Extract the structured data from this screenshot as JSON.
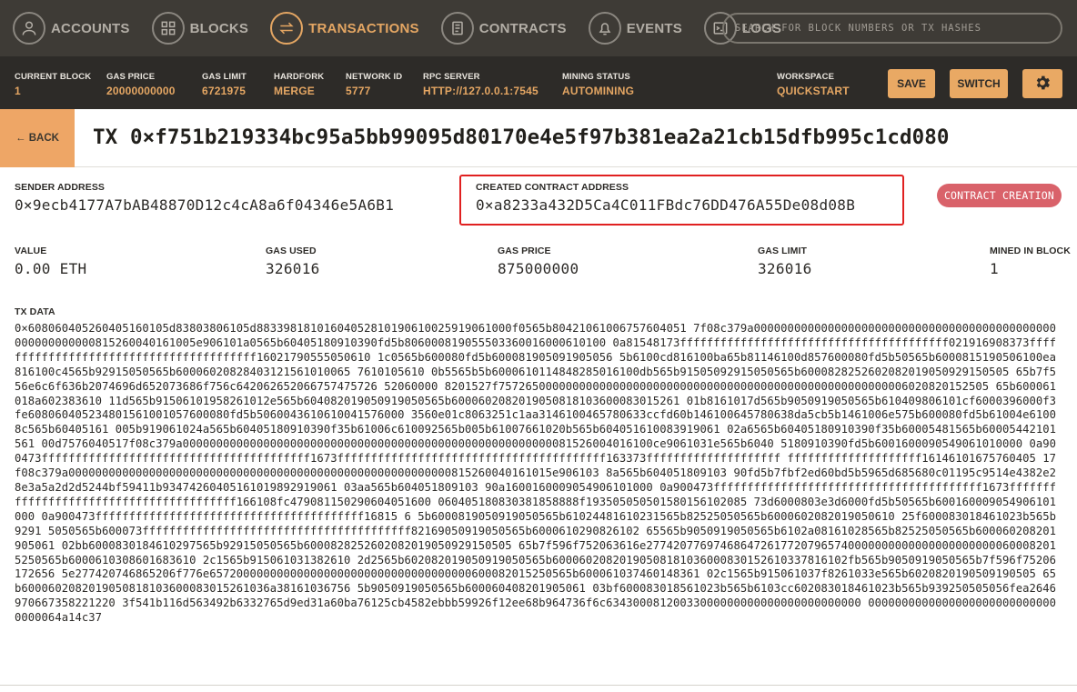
{
  "nav": {
    "items": [
      {
        "label": "ACCOUNTS",
        "icon": "user-icon"
      },
      {
        "label": "BLOCKS",
        "icon": "grid-icon"
      },
      {
        "label": "TRANSACTIONS",
        "icon": "swap-arrows-icon"
      },
      {
        "label": "CONTRACTS",
        "icon": "document-icon"
      },
      {
        "label": "EVENTS",
        "icon": "bell-icon"
      },
      {
        "label": "LOGS",
        "icon": "terminal-icon"
      }
    ],
    "active": "TRANSACTIONS",
    "search_placeholder": "SEARCH FOR BLOCK NUMBERS OR TX HASHES"
  },
  "status": {
    "current_block": {
      "label": "CURRENT BLOCK",
      "value": "1"
    },
    "gas_price": {
      "label": "GAS PRICE",
      "value": "20000000000"
    },
    "gas_limit": {
      "label": "GAS LIMIT",
      "value": "6721975"
    },
    "hardfork": {
      "label": "HARDFORK",
      "value": "MERGE"
    },
    "network_id": {
      "label": "NETWORK ID",
      "value": "5777"
    },
    "rpc_server": {
      "label": "RPC SERVER",
      "value": "HTTP://127.0.0.1:7545"
    },
    "mining_status": {
      "label": "MINING STATUS",
      "value": "AUTOMINING"
    },
    "workspace": {
      "label": "WORKSPACE",
      "value": "QUICKSTART"
    },
    "save_label": "SAVE",
    "switch_label": "SWITCH",
    "settings_icon": "gear-icon"
  },
  "header": {
    "back_label": "← BACK",
    "title": "TX 0×f751b219334bc95a5bb99095d80170e4e5f97b381ea2a21cb15dfb995c1cd080"
  },
  "tx": {
    "sender": {
      "label": "SENDER ADDRESS",
      "value": "0×9ecb4177A7bAB48870D12c4cA8a6f04346e5A6B1"
    },
    "created_contract": {
      "label": "CREATED CONTRACT ADDRESS",
      "value": "0×a8233a432D5Ca4C011FBdc76DD476A55De08d08B"
    },
    "badge": "CONTRACT CREATION",
    "value": {
      "label": "VALUE",
      "value": "0.00 ETH"
    },
    "gas_used": {
      "label": "GAS USED",
      "value": "326016"
    },
    "gas_price": {
      "label": "GAS PRICE",
      "value": "875000000"
    },
    "gas_limit": {
      "label": "GAS LIMIT",
      "value": "326016"
    },
    "mined_in_block": {
      "label": "MINED IN BLOCK",
      "value": "1"
    },
    "data_label": "TX DATA",
    "data": "0×608060405260405160105d83803806105d88339818101604052810190610025919061000f0565b80421061006757604051 7f08c379a000000000000000000000000000000000000000000000000000000000815260040161005e906101a0565b60405180910390fd5b806000819055503360016000610100 0a81548173ffffffffffffffffffffffffffffffffffffffff021916908373ffffffffffffffffffffffffffffffffffffffff16021790555050610 1c0565b600080fd5b600081905091905056 5b6100cd816100ba65b81146100d857600080fd5b50565b6000815190506100ea816100c4565b92915050565b60006020828403121561010065 7610105610 0b5565b5b6000610114848285016100db565b91505092915050565b6000828252602082019050929150505 65b7f556e6c6f636b2074696d652073686f756c642062652066757475726 52060000 8201527f7572650000000000000000000000000000000000000000000000000000006020820152505 65b600061018a602383610 11d565b91506101958261012e565b604082019050919050565b6000602082019050818103600083015261 01b8161017d565b9050919050565b610409806101cf6000396000f3fe608060405234801561001057600080fd5b5060043610610041576000 3560e01c8063251c1aa3146100465780633ccfd60b146100645780638da5cb5b1461006e575b600080fd5b61004e61008c565b60405161 005b919061024a565b60405180910390f35b61006c610092565b005b61007661020b565b604051610083919061 02a6565b60405180910390f35b60005481565b60005442101561 00d7576040517f08c379a0000000000000000000000000000000000000000000000000000000081526004016100ce9061031e565b6040 5180910390fd5b6001600090549061010000 0a900473ffffffffffffffffffffffffffffffffffffffff1673ffffffffffffffffffffffffffffffffffffffff163373ffffffffffffffffffff ffffffffffffffffffff16146101675760405 17f08c379a000000000000000000000000000000000000000000000000000000000815260040161015e906103 8a565b604051809103 90fd5b7fbf2ed60bd5b5965d685680c01195c9514e4382e28e3a5a2d2d5244bf59411b93474260405161019892919061 03aa565b604051809103 90a1600160009054906101000 0a900473ffffffffffffffffffffffffffffffffffffffff1673ffffffffffffffffffffffffffffffffffffffff166108fc479081150290604051600 060405180830381858888f193505050501580156102085 73d6000803e3d6000fd5b50565b600160009054906101000 0a900473ffffffffffffffffffffffffffffffffffffffff16815 6 5b6000819050919050565b61024481610231565b82525050565b6000602082019050610 25f600083018461023b565b9291 5050565b600073ffffffffffffffffffffffffffffffffffffffff82169050919050565b6000610290826102 65565b9050919050565b6102a08161028565b82525050565b600060208201905061 02bb6000830184610297565b92915050565b6000828252602082019050929150505 65b7f596f752063616e27742077697468647261772079657400000000000000000000000600082015250565b6000610308601683610 2c1565b915061031382610 2d2565b602082019050919050565b60006020820190508181036000830152610337816102fb565b9050919050565b7f596f75206172656 5e277420746865206f776e657200000000000000000000000000000000000600082015250565b600061037460148361 02c1565b915061037f8261033e565b6020820190509190505 65b6000602082019050818103600083015261036a38161036756 5b9050919050565b600060408201905061 03bf600083018561023b565b6103cc602083018461023b565b939250505056fea2646970667358221220 3f541b116d563492b6332765d9ed31a60ba76125cb4582ebbb59926f12ee68b964736f6c63430008120033000000000000000000000000 00000000000000000000000000000000064a14c37"
  }
}
